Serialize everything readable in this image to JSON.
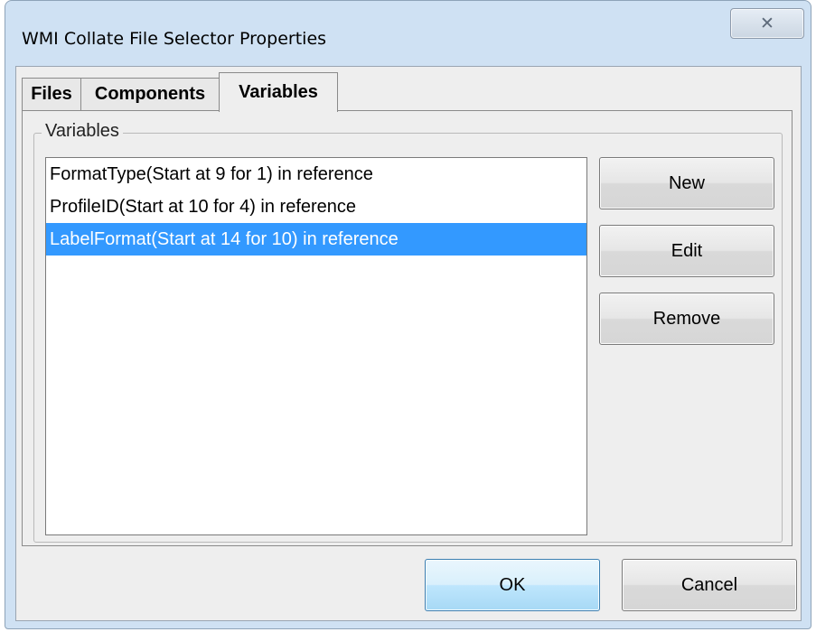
{
  "window": {
    "title": "WMI Collate File Selector Properties",
    "close_symbol": "⌦"
  },
  "tabs": [
    {
      "label": "Files",
      "active": false
    },
    {
      "label": "Components",
      "active": false
    },
    {
      "label": "Variables",
      "active": true
    }
  ],
  "variables_group": {
    "legend": "Variables",
    "items": [
      {
        "label": "FormatType(Start at 9 for 1) in reference",
        "selected": false
      },
      {
        "label": "ProfileID(Start at 10 for 4) in reference",
        "selected": false
      },
      {
        "label": "LabelFormat(Start at 14 for 10) in reference",
        "selected": true
      }
    ],
    "buttons": {
      "new": "New",
      "edit": "Edit",
      "remove": "Remove"
    }
  },
  "footer": {
    "ok": "OK",
    "cancel": "Cancel"
  },
  "colors": {
    "selection": "#3399ff",
    "title_bar": "#cfe1f3",
    "client_bg": "#eeeeee"
  },
  "icons": [
    "close-icon"
  ]
}
